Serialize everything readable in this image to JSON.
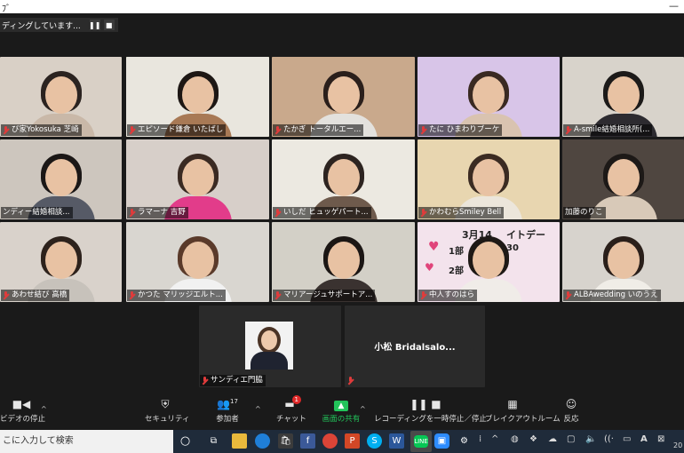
{
  "window": {
    "title": "ﾌﾞ",
    "minimize": "—"
  },
  "recording": {
    "status": "ディングしています...",
    "pause": "❚❚",
    "stop": "■"
  },
  "participants": [
    {
      "name": "び家Yokosuka 芝崎",
      "muted": true,
      "bg": "#d9d0c6",
      "hair": "#2b2320",
      "shirt": "#c9b8a8"
    },
    {
      "name": "エピソード鎌倉 いたばし",
      "muted": true,
      "bg": "#e9e6de",
      "hair": "#1d1714",
      "shirt": "#a87955",
      "active": true
    },
    {
      "name": "たかぎ トータルエー...",
      "muted": true,
      "bg": "#c9a98c",
      "hair": "#2a1f1b",
      "shirt": "#e3e1dd"
    },
    {
      "name": "たに ひまわりブーケ",
      "muted": true,
      "bg": "#d8c5e8",
      "hair": "#3a2a22",
      "shirt": "#d9c3b0"
    },
    {
      "name": "A-smile結婚相談所(...",
      "muted": true,
      "bg": "#d8d3cb",
      "hair": "#1c1a19",
      "shirt": "#2d2b30"
    },
    {
      "name": "ンディー結婚相談...",
      "muted": false,
      "bg": "#cdc6be",
      "hair": "#1b1716",
      "shirt": "#565a66"
    },
    {
      "name": "ラマーナ 吉野",
      "muted": true,
      "bg": "#d7cfc9",
      "hair": "#3a2a22",
      "shirt": "#e23c8a"
    },
    {
      "name": "いしだ ヒュッゲパート...",
      "muted": true,
      "bg": "#ece9e1",
      "hair": "#2d2420",
      "shirt": "#6e5a4c"
    },
    {
      "name": "かわむらSmiley Bell",
      "muted": true,
      "bg": "#e8d6b0",
      "hair": "#3b2b22",
      "shirt": "#ece6db"
    },
    {
      "name": "加藤のりこ",
      "muted": false,
      "bg": "#4f4640",
      "hair": "#1d1917",
      "shirt": "#d8c9b8"
    },
    {
      "name": "あわせ結び 高橋",
      "muted": true,
      "bg": "#d9d2cb",
      "hair": "#2d221c",
      "shirt": "#c7c2bb"
    },
    {
      "name": "かつた マリッジエルト...",
      "muted": true,
      "bg": "#d9d6d0",
      "hair": "#5a3a2a",
      "shirt": "#f1f1f1"
    },
    {
      "name": "マリアージュサポートア...",
      "muted": true,
      "bg": "#d3d0c7",
      "hair": "#1b1614",
      "shirt": "#3a3230"
    },
    {
      "name": "中人すのはら",
      "muted": true,
      "bg": "#f3e3ec",
      "hair": "#1e1916",
      "shirt": "#f0ece8"
    },
    {
      "name": "ALBAwedding いのうえ",
      "muted": true,
      "bg": "#d7d3cd",
      "hair": "#2a1f1a",
      "shirt": "#f0ede7"
    }
  ],
  "poster": {
    "line1": "3月14",
    "suffix": "イトデー",
    "part1": "1部",
    "part2": "2部",
    "time": "30"
  },
  "bottom_tiles": [
    {
      "name": "サンディエ門脇",
      "muted": true
    },
    {
      "name": "小松 Bridalsalo...",
      "muted": true
    }
  ],
  "toolbar": {
    "video": "ビデオの停止",
    "security": "セキュリティ",
    "participants": "参加者",
    "participants_count": "17",
    "chat": "チャット",
    "chat_badge": "1",
    "share": "画面の共有",
    "recording": "レコーディングを一時停止／停止",
    "breakout": "ブレイクアウトルーム",
    "reactions": "反応"
  },
  "taskbar": {
    "search_placeholder": "こに入力して検索",
    "year": "20"
  },
  "colors": {
    "active_border": "#b8e04a",
    "share_green": "#22c35a",
    "mute_red": "#e03b3b"
  }
}
